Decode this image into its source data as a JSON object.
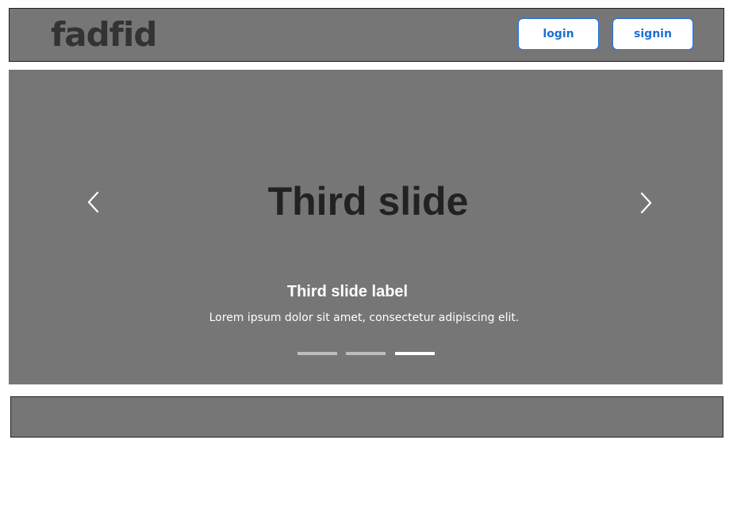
{
  "header": {
    "logo": "fadfid",
    "login_label": "login",
    "signin_label": "signin"
  },
  "carousel": {
    "slide_title": "Third slide",
    "caption_label": "Third slide label",
    "caption_text": "Lorem ipsum dolor sit amet, consectetur adipiscing elit.",
    "active_index": 2,
    "indicator_count": 3,
    "prev_icon": "chevron-left-icon",
    "next_icon": "chevron-right-icon"
  },
  "colors": {
    "panel_bg": "#767676",
    "logo": "#333333",
    "button_text": "#1a6fd1",
    "button_border": "#1a73e8",
    "title": "#222222",
    "caption": "#ffffff",
    "indicator_active": "#ffffff",
    "indicator_inactive": "#bdbdbd"
  }
}
